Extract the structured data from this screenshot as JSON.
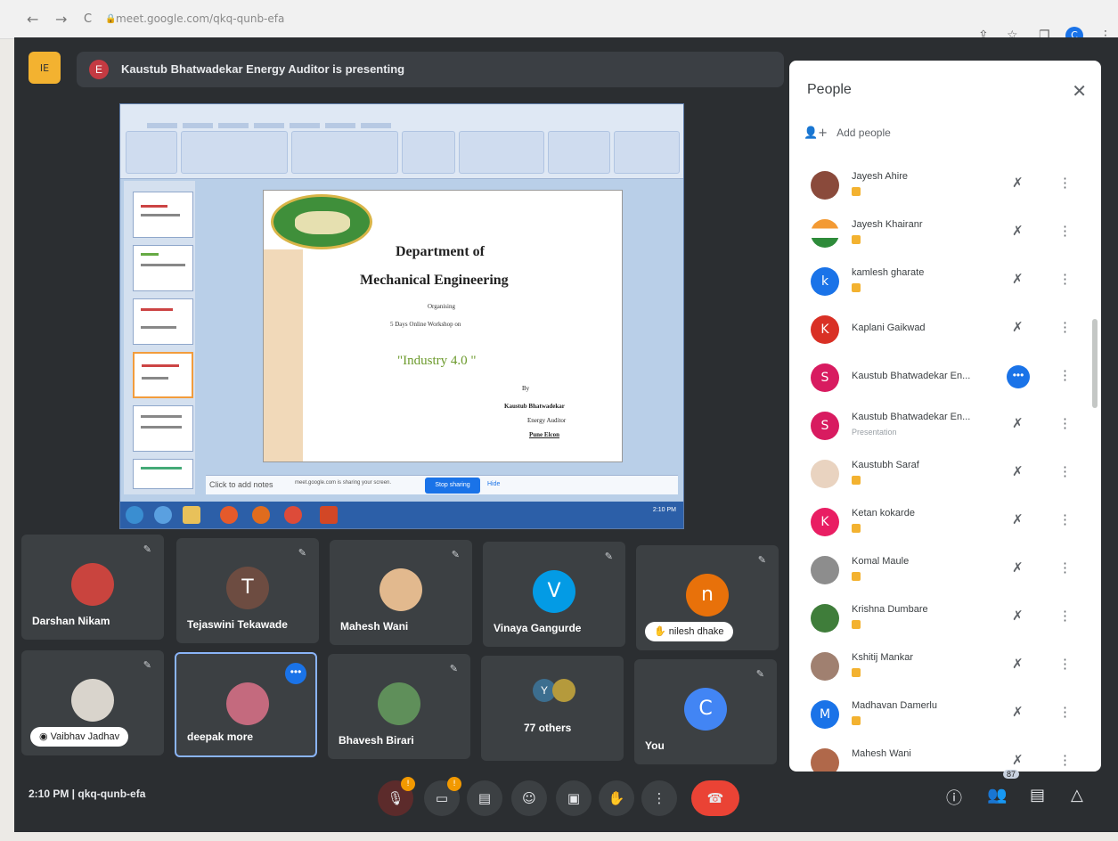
{
  "browser": {
    "back": "←",
    "forward": "→",
    "reload": "C",
    "url": "meet.google.com/qkq-qunb-efa",
    "share_icon": "⇪",
    "star": "☆",
    "panel": "❐",
    "profile": "C",
    "menu": "⋮"
  },
  "presenting": {
    "avatar_letter": "E",
    "text": "Kaustub Bhatwadekar Energy Auditor is presenting"
  },
  "slide": {
    "h1": "Department of",
    "h2": "Mechanical Engineering",
    "organising": "Organising",
    "workshop": "5 Days Online Workshop on",
    "topic": "\"Industry 4.0 \"",
    "by": "By",
    "presenter": "Kaustub Bhatwadekar",
    "role": "Energy Auditor",
    "place": "Pune Elcon"
  },
  "notes": {
    "click_to_add": "Click to add notes",
    "sharing_notice": "meet.google.com is sharing your screen.",
    "stop_sharing": "Stop sharing",
    "hide": "Hide"
  },
  "tiles": [
    {
      "name": "Darshan Nikam"
    },
    {
      "name": "Tejaswini Tekawade",
      "letter": "T"
    },
    {
      "name": "Mahesh Wani"
    },
    {
      "name": "Vinaya Gangurde",
      "letter": "V"
    },
    {
      "name": "nilesh dhake",
      "letter": "n"
    },
    {
      "name": "Vaibhav Jadhav"
    },
    {
      "name": "deepak more"
    },
    {
      "name": "Bhavesh Birari"
    },
    {
      "name": "77 others",
      "letter": "Y"
    },
    {
      "name": "You",
      "letter": "C"
    }
  ],
  "people": {
    "title": "People",
    "close": "✕",
    "add_icon": "👤+",
    "add_label": "Add people",
    "rows": [
      {
        "name": "Jayesh Ahire"
      },
      {
        "name": "Jayesh Khairanr"
      },
      {
        "name": "kamlesh gharate",
        "letter": "k"
      },
      {
        "name": "Kaplani Gaikwad",
        "letter": "K"
      },
      {
        "name": "Kaustub Bhatwadekar En...",
        "letter": "S"
      },
      {
        "name": "Kaustub Bhatwadekar En...",
        "letter": "S",
        "sub": "Presentation"
      },
      {
        "name": "Kaustubh Saraf"
      },
      {
        "name": "Ketan kokarde",
        "letter": "K"
      },
      {
        "name": "Komal Maule"
      },
      {
        "name": "Krishna Dumbare"
      },
      {
        "name": "Kshitij Mankar"
      },
      {
        "name": "Madhavan Damerlu",
        "letter": "M"
      },
      {
        "name": "Mahesh Wani"
      }
    ],
    "mic_icon": "🎙̸",
    "kebab": "⋮",
    "more": "•••"
  },
  "bottom": {
    "time": "2:10 PM  |  qkq-qunb-efa",
    "people_count": "87",
    "hang_up_icon": "☎"
  }
}
